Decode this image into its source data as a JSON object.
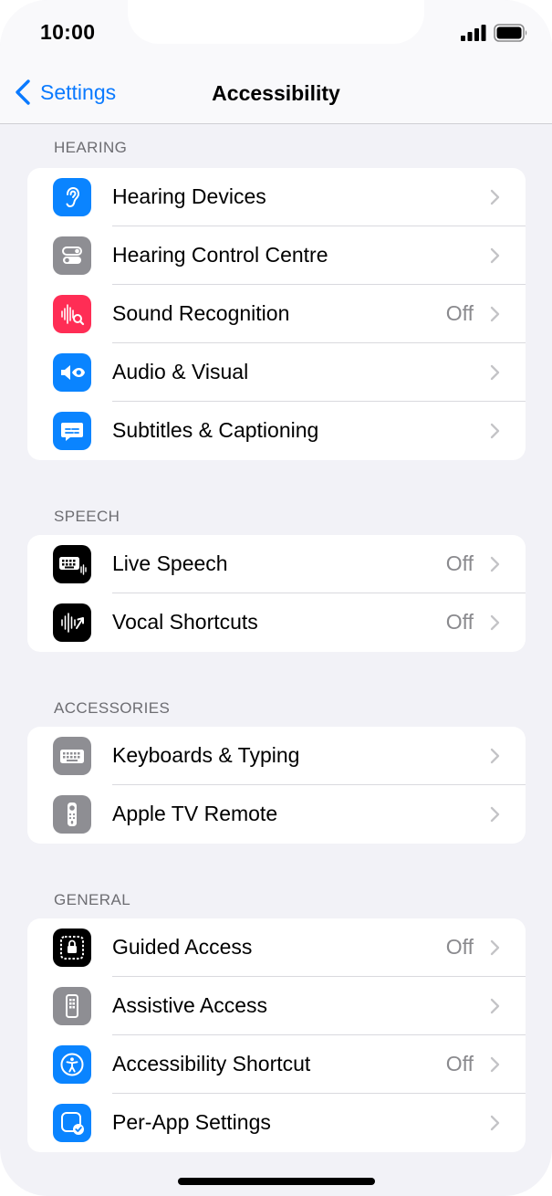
{
  "status": {
    "time": "10:00"
  },
  "nav": {
    "back_label": "Settings",
    "title": "Accessibility"
  },
  "sections": [
    {
      "header": "HEARING",
      "rows": [
        {
          "label": "Hearing Devices",
          "value": "",
          "icon": "ear-icon",
          "icon_color": "#0a84ff"
        },
        {
          "label": "Hearing Control Centre",
          "value": "",
          "icon": "toggles-icon",
          "icon_color": "#8e8e93"
        },
        {
          "label": "Sound Recognition",
          "value": "Off",
          "icon": "waveform-search-icon",
          "icon_color": "#ff2d55"
        },
        {
          "label": "Audio & Visual",
          "value": "",
          "icon": "speaker-eye-icon",
          "icon_color": "#0a84ff"
        },
        {
          "label": "Subtitles & Captioning",
          "value": "",
          "icon": "caption-bubble-icon",
          "icon_color": "#0a84ff"
        }
      ]
    },
    {
      "header": "SPEECH",
      "rows": [
        {
          "label": "Live Speech",
          "value": "Off",
          "icon": "keyboard-wave-icon",
          "icon_color": "#000000"
        },
        {
          "label": "Vocal Shortcuts",
          "value": "Off",
          "icon": "waveform-arrow-icon",
          "icon_color": "#000000"
        }
      ]
    },
    {
      "header": "ACCESSORIES",
      "rows": [
        {
          "label": "Keyboards & Typing",
          "value": "",
          "icon": "keyboard-icon",
          "icon_color": "#8e8e93"
        },
        {
          "label": "Apple TV Remote",
          "value": "",
          "icon": "remote-icon",
          "icon_color": "#8e8e93"
        }
      ]
    },
    {
      "header": "GENERAL",
      "rows": [
        {
          "label": "Guided Access",
          "value": "Off",
          "icon": "lock-frame-icon",
          "icon_color": "#000000"
        },
        {
          "label": "Assistive Access",
          "value": "",
          "icon": "phone-grid-icon",
          "icon_color": "#8e8e93"
        },
        {
          "label": "Accessibility Shortcut",
          "value": "Off",
          "icon": "accessibility-icon",
          "icon_color": "#0a84ff"
        },
        {
          "label": "Per-App Settings",
          "value": "",
          "icon": "app-check-icon",
          "icon_color": "#0a84ff"
        }
      ]
    }
  ]
}
